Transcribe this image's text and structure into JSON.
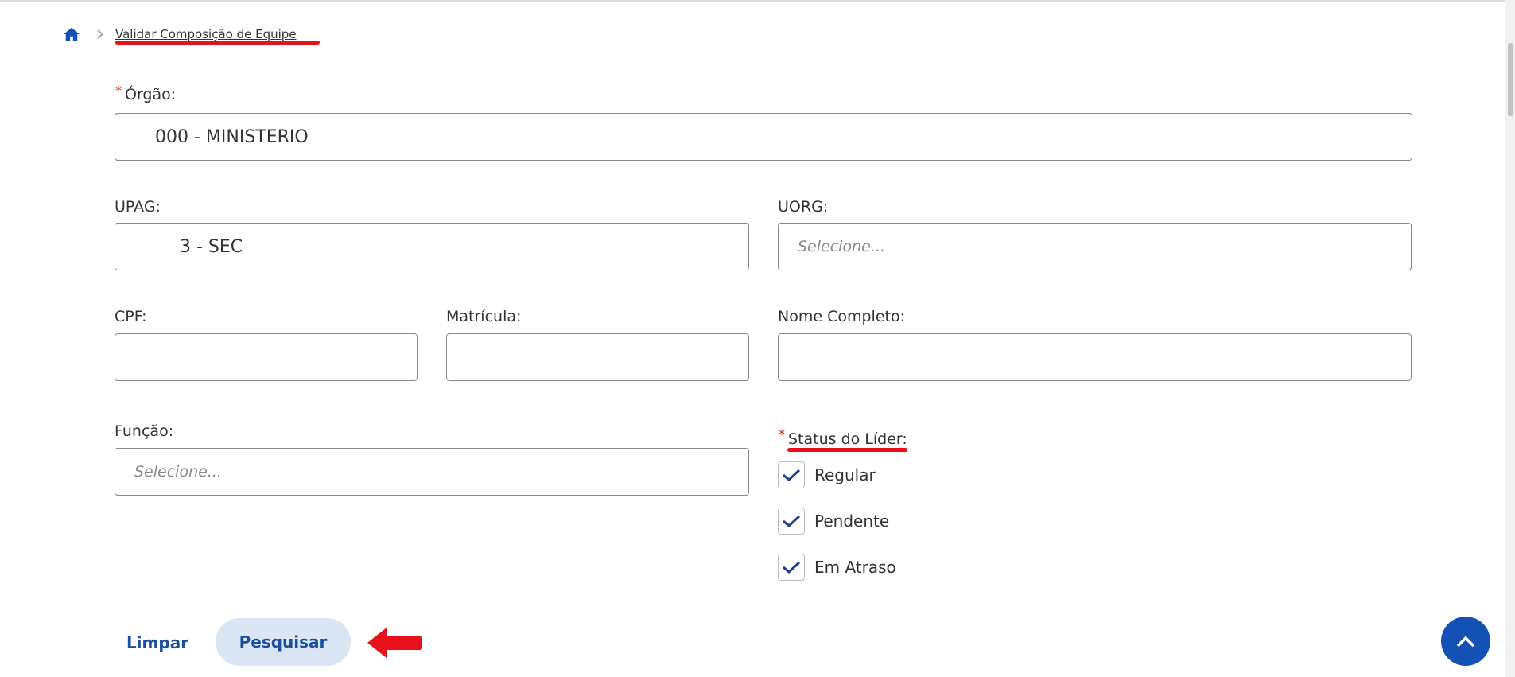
{
  "breadcrumb": {
    "home_icon": "home-icon",
    "separator_icon": "chevron-right-icon",
    "current": "Validar Composição de Equipe"
  },
  "form": {
    "orgao": {
      "label": "Órgão:",
      "value": "000 - MINISTERIO",
      "required_mark": "*"
    },
    "upag": {
      "label": "UPAG:",
      "value": "3 - SEC"
    },
    "uorg": {
      "label": "UORG:",
      "placeholder": "Selecione..."
    },
    "cpf": {
      "label": "CPF:",
      "value": ""
    },
    "matricula": {
      "label": "Matrícula:",
      "value": ""
    },
    "nome": {
      "label": "Nome Completo:",
      "value": ""
    },
    "funcao": {
      "label": "Função:",
      "placeholder": "Selecione..."
    },
    "status": {
      "label": "Status do Líder:",
      "required_mark": "*",
      "options": [
        {
          "label": "Regular",
          "checked": true
        },
        {
          "label": "Pendente",
          "checked": true
        },
        {
          "label": "Em Atraso",
          "checked": true
        }
      ]
    }
  },
  "actions": {
    "clear": "Limpar",
    "search": "Pesquisar"
  },
  "colors": {
    "accent": "#1451b4",
    "annotation": "#e8101a",
    "required": "#e52207"
  }
}
